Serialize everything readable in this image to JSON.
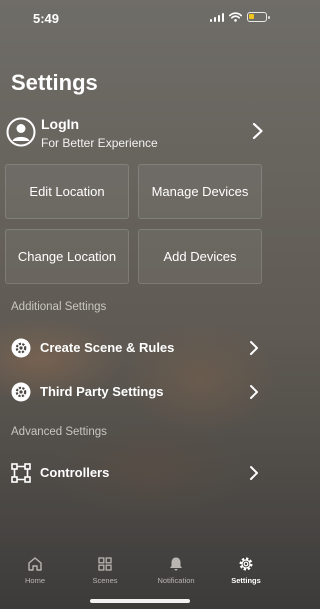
{
  "status_bar": {
    "time": "5:49",
    "battery_level": 0.3,
    "battery_color": "#f0c419"
  },
  "title": "Settings",
  "login": {
    "title": "LogIn",
    "subtitle": "For Better Experience",
    "icon": "user-circle-icon"
  },
  "tiles": [
    {
      "label": "Edit Location"
    },
    {
      "label": "Manage Devices"
    },
    {
      "label": "Change Location"
    },
    {
      "label": "Add Devices"
    }
  ],
  "sections": {
    "additional": {
      "label": "Additional Settings",
      "items": [
        {
          "label": "Create Scene & Rules",
          "icon": "scene-icon"
        },
        {
          "label": "Third Party Settings",
          "icon": "third-party-icon"
        }
      ]
    },
    "advanced": {
      "label": "Advanced Settings",
      "items": [
        {
          "label": "Controllers",
          "icon": "controllers-icon"
        }
      ]
    }
  },
  "tab_bar": {
    "active": "Settings",
    "tabs": [
      {
        "label": "Home",
        "icon": "home-icon"
      },
      {
        "label": "Scenes",
        "icon": "grid-icon"
      },
      {
        "label": "Notification",
        "icon": "bell-icon"
      },
      {
        "label": "Settings",
        "icon": "gear-icon"
      }
    ]
  }
}
